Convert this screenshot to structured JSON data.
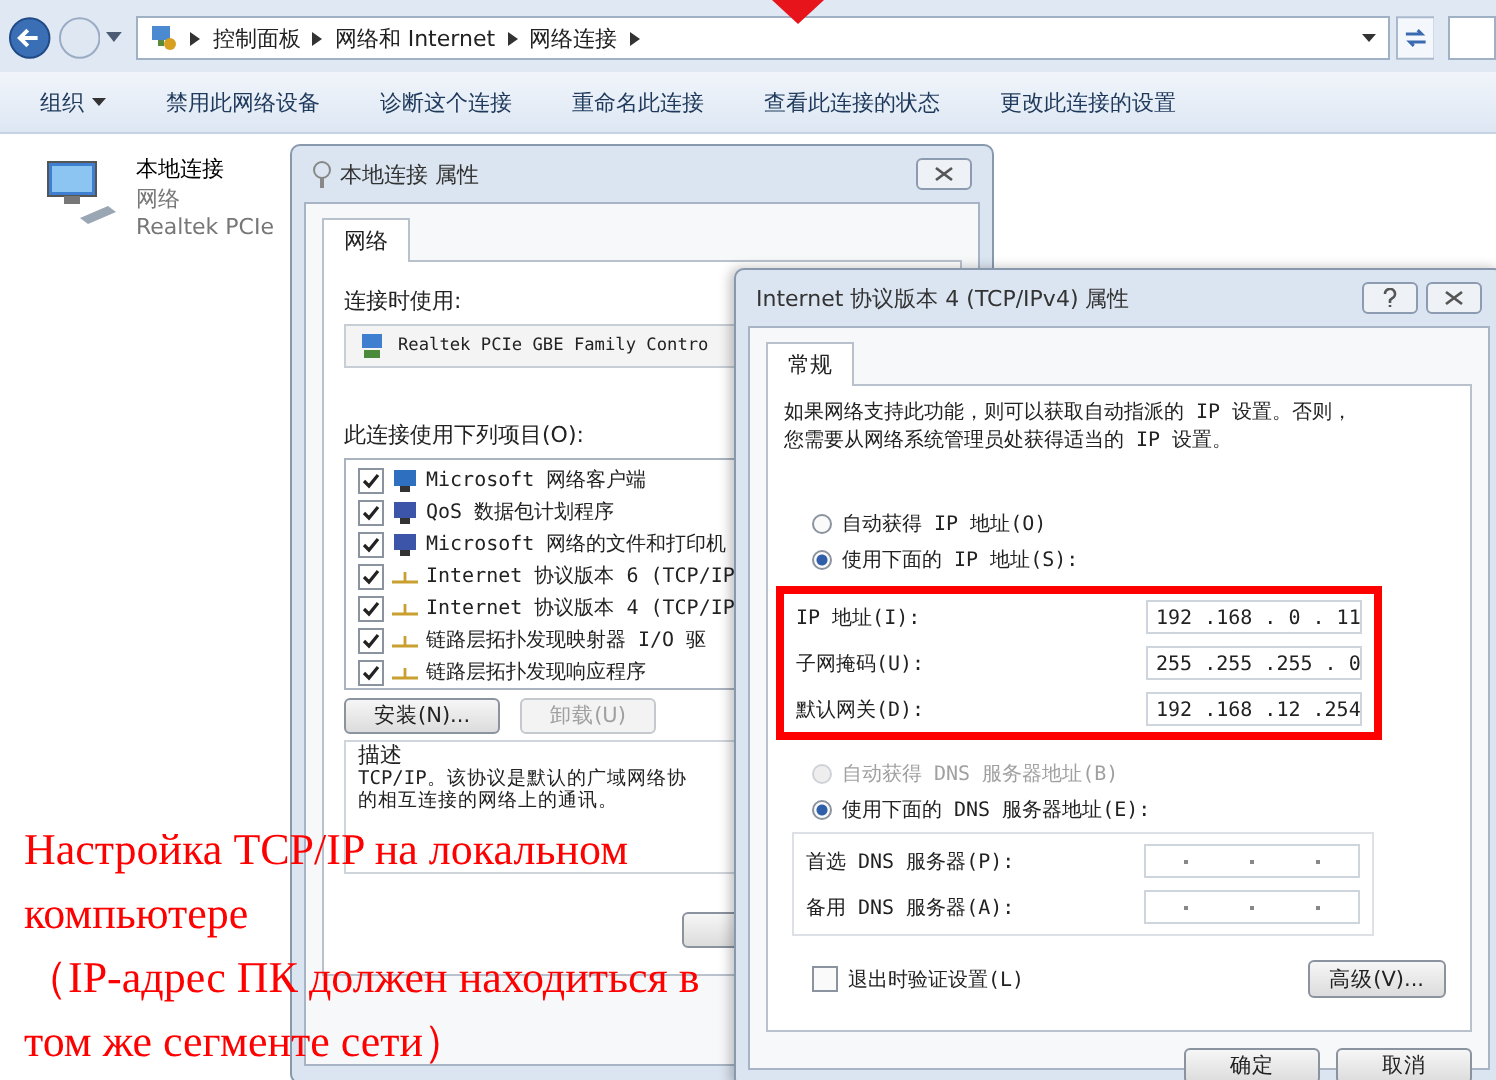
{
  "explorer": {
    "breadcrumb": [
      "控制面板",
      "网络和 Internet",
      "网络连接"
    ],
    "toolbar": [
      {
        "label": "组织",
        "menu": true
      },
      {
        "label": "禁用此网络设备",
        "menu": false
      },
      {
        "label": "诊断这个连接",
        "menu": false
      },
      {
        "label": "重命名此连接",
        "menu": false
      },
      {
        "label": "查看此连接的状态",
        "menu": false
      },
      {
        "label": "更改此连接的设置",
        "menu": false
      }
    ],
    "connection": {
      "name": "本地连接",
      "status": "网络",
      "adapter": "Realtek PCIe"
    }
  },
  "properties_dialog": {
    "title": "本地连接 属性",
    "tabs": [
      {
        "label": "网络",
        "selected": true
      }
    ],
    "connect_using_label": "连接时使用:",
    "adapter": "Realtek PCIe GBE Family Contro",
    "items_label": "此连接使用下列项目(O):",
    "items": [
      {
        "label": "Microsoft 网络客户端",
        "checked": true,
        "kind": "client"
      },
      {
        "label": "QoS 数据包计划程序",
        "checked": true,
        "kind": "service"
      },
      {
        "label": "Microsoft 网络的文件和打印机",
        "checked": true,
        "kind": "service"
      },
      {
        "label": "Internet 协议版本 6 (TCP/IP",
        "checked": true,
        "kind": "protocol"
      },
      {
        "label": "Internet 协议版本 4 (TCP/IP",
        "checked": true,
        "kind": "protocol"
      },
      {
        "label": "链路层拓扑发现映射器 I/O 驱",
        "checked": true,
        "kind": "protocol"
      },
      {
        "label": "链路层拓扑发现响应程序",
        "checked": true,
        "kind": "protocol"
      }
    ],
    "buttons": [
      {
        "label": "安装(N)...",
        "disabled": false
      },
      {
        "label": "卸载(U)",
        "disabled": true
      }
    ],
    "description_label": "描述",
    "description": [
      "TCP/IP。该协议是默认的广域网络协",
      "的相互连接的网络上的通讯。"
    ]
  },
  "ipv4_dialog": {
    "title": "Internet 协议版本 4 (TCP/IPv4) 属性",
    "tabs": [
      {
        "label": "常规",
        "selected": true
      }
    ],
    "intro": [
      "如果网络支持此功能，则可以获取自动指派的 IP 设置。否则，",
      "您需要从网络系统管理员处获得适当的 IP 设置。"
    ],
    "ip_options": [
      {
        "label": "自动获得 IP 地址(O)",
        "selected": false,
        "disabled": false
      },
      {
        "label": "使用下面的 IP 地址(S):",
        "selected": true,
        "disabled": false
      }
    ],
    "ip_fields": [
      {
        "label": "IP 地址(I):",
        "value": "192 .168 . 0 . 11"
      },
      {
        "label": "子网掩码(U):",
        "value": "255 .255 .255 . 0"
      },
      {
        "label": "默认网关(D):",
        "value": "192 .168 .12 .254"
      }
    ],
    "dns_options": [
      {
        "label": "自动获得 DNS 服务器地址(B)",
        "selected": false,
        "disabled": true
      },
      {
        "label": "使用下面的 DNS 服务器地址(E):",
        "selected": true,
        "disabled": false
      }
    ],
    "dns_fields": [
      {
        "label": "首选 DNS 服务器(P):"
      },
      {
        "label": "备用 DNS 服务器(A):"
      }
    ],
    "validate": {
      "label": "退出时验证设置(L)",
      "checked": false
    },
    "advanced_button": "高级(V)...",
    "buttons": [
      "确定",
      "取消"
    ]
  },
  "annotation": [
    "Настройка TCP/IP на локальном",
    "компьютере",
    "（IP-адрес ПК должен находиться в",
    "том же сегменте сети）"
  ]
}
